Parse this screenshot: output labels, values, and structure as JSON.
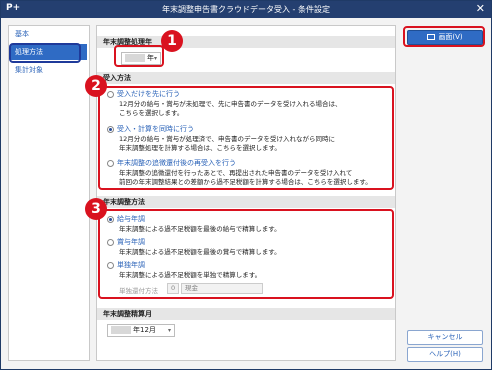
{
  "window": {
    "title": "年末調整申告書クラウドデータ受入 - 条件設定",
    "app_icon": "P+",
    "close_glyph": "✕"
  },
  "sidebar": {
    "items": [
      {
        "label": "基本"
      },
      {
        "label": "処理方法"
      },
      {
        "label": "集計対象"
      }
    ]
  },
  "sections": {
    "year": {
      "title": "年末調整処理年",
      "value_suffix": "年"
    },
    "receive": {
      "title": "受入方法",
      "options": [
        {
          "label": "受入だけを先に行う",
          "desc": [
            "12月分の給与・賞与が未処理で、先に申告書のデータを受け入れる場合は、",
            "こちらを選択します。"
          ]
        },
        {
          "label": "受入・計算を同時に行う",
          "desc": [
            "12月分の給与・賞与が処理済で、申告書のデータを受け入れながら同時に",
            "年末調整処理を計算する場合は、こちらを選択します。"
          ]
        },
        {
          "label": "年末調整の追徴還付後の再受入を行う",
          "desc": [
            "年末調整の追徴還付を行ったあとで、再提出された申告書のデータを受け入れて",
            "前回の年末調整結果との差額から過不足税額を計算する場合は、こちらを選択します。"
          ]
        }
      ]
    },
    "calc": {
      "title": "年末調整方法",
      "options": [
        {
          "label": "給与年調",
          "desc": "年末調整による過不足税額を最後の給与で精算します。"
        },
        {
          "label": "賞与年調",
          "desc": "年末調整による過不足税額を最後の賞与で精算します。"
        },
        {
          "label": "単独年調",
          "desc": "年末調整による過不足税額を単独で精算します。"
        }
      ],
      "refund_label": "単独還付方法",
      "refund_code": "0",
      "refund_value": "現金"
    },
    "month": {
      "title": "年末調整精算月",
      "value_suffix": "年12月"
    }
  },
  "buttons": {
    "ok": "画面(V)",
    "cancel": "キャンセル",
    "help": "ヘルプ(H)"
  },
  "annotations": [
    "1",
    "2",
    "3"
  ],
  "colors": {
    "titlebar": "#243f70",
    "accent": "#2f6bc4",
    "annotation": "#d9121f"
  }
}
